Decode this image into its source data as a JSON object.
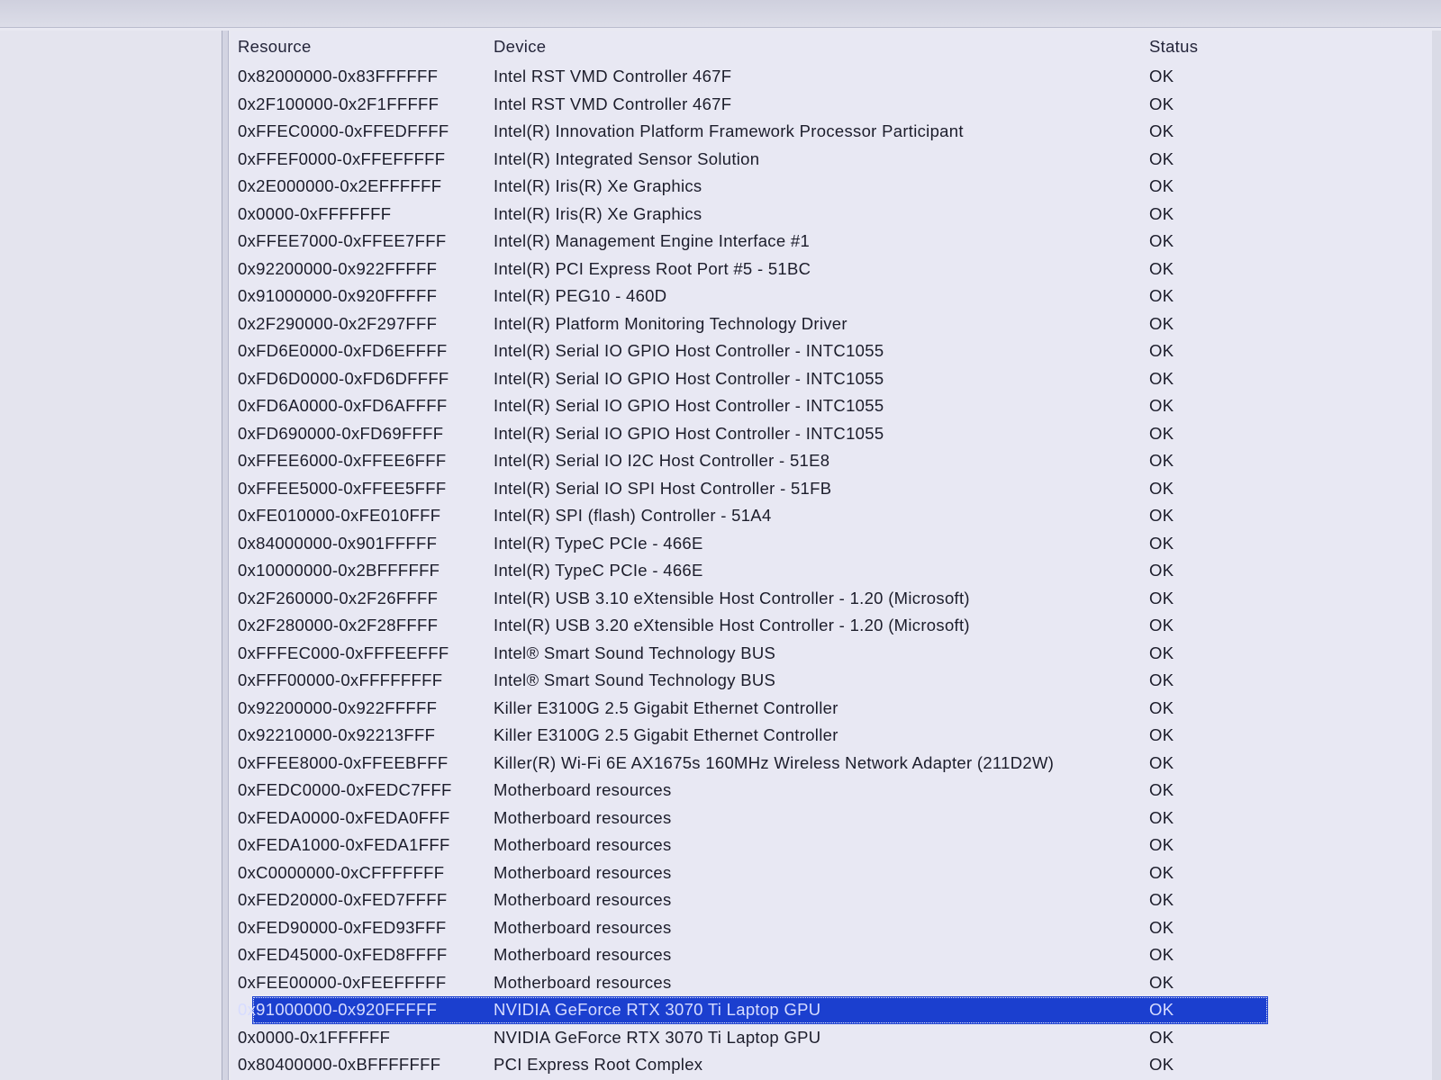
{
  "columns": {
    "resource": "Resource",
    "device": "Device",
    "status": "Status"
  },
  "rows": [
    {
      "resource": "0x82000000-0x83FFFFFF",
      "device": "Intel RST VMD Controller 467F",
      "status": "OK"
    },
    {
      "resource": "0x2F100000-0x2F1FFFFF",
      "device": "Intel RST VMD Controller 467F",
      "status": "OK"
    },
    {
      "resource": "0xFFEC0000-0xFFEDFFFF",
      "device": "Intel(R) Innovation Platform Framework Processor Participant",
      "status": "OK"
    },
    {
      "resource": "0xFFEF0000-0xFFEFFFFF",
      "device": "Intel(R) Integrated Sensor Solution",
      "status": "OK"
    },
    {
      "resource": "0x2E000000-0x2EFFFFFF",
      "device": "Intel(R) Iris(R) Xe Graphics",
      "status": "OK"
    },
    {
      "resource": "0x0000-0xFFFFFFF",
      "device": "Intel(R) Iris(R) Xe Graphics",
      "status": "OK"
    },
    {
      "resource": "0xFFEE7000-0xFFEE7FFF",
      "device": "Intel(R) Management Engine Interface #1",
      "status": "OK"
    },
    {
      "resource": "0x92200000-0x922FFFFF",
      "device": "Intel(R) PCI Express Root Port #5 - 51BC",
      "status": "OK"
    },
    {
      "resource": "0x91000000-0x920FFFFF",
      "device": "Intel(R) PEG10 - 460D",
      "status": "OK"
    },
    {
      "resource": "0x2F290000-0x2F297FFF",
      "device": "Intel(R) Platform Monitoring Technology Driver",
      "status": "OK"
    },
    {
      "resource": "0xFD6E0000-0xFD6EFFFF",
      "device": "Intel(R) Serial IO GPIO Host Controller - INTC1055",
      "status": "OK"
    },
    {
      "resource": "0xFD6D0000-0xFD6DFFFF",
      "device": "Intel(R) Serial IO GPIO Host Controller - INTC1055",
      "status": "OK"
    },
    {
      "resource": "0xFD6A0000-0xFD6AFFFF",
      "device": "Intel(R) Serial IO GPIO Host Controller - INTC1055",
      "status": "OK"
    },
    {
      "resource": "0xFD690000-0xFD69FFFF",
      "device": "Intel(R) Serial IO GPIO Host Controller - INTC1055",
      "status": "OK"
    },
    {
      "resource": "0xFFEE6000-0xFFEE6FFF",
      "device": "Intel(R) Serial IO I2C Host Controller - 51E8",
      "status": "OK"
    },
    {
      "resource": "0xFFEE5000-0xFFEE5FFF",
      "device": "Intel(R) Serial IO SPI Host Controller - 51FB",
      "status": "OK"
    },
    {
      "resource": "0xFE010000-0xFE010FFF",
      "device": "Intel(R) SPI (flash) Controller - 51A4",
      "status": "OK"
    },
    {
      "resource": "0x84000000-0x901FFFFF",
      "device": "Intel(R) TypeC PCIe - 466E",
      "status": "OK"
    },
    {
      "resource": "0x10000000-0x2BFFFFFF",
      "device": "Intel(R) TypeC PCIe - 466E",
      "status": "OK"
    },
    {
      "resource": "0x2F260000-0x2F26FFFF",
      "device": "Intel(R) USB 3.10 eXtensible Host Controller - 1.20 (Microsoft)",
      "status": "OK"
    },
    {
      "resource": "0x2F280000-0x2F28FFFF",
      "device": "Intel(R) USB 3.20 eXtensible Host Controller - 1.20 (Microsoft)",
      "status": "OK"
    },
    {
      "resource": "0xFFFEC000-0xFFFEEFFF",
      "device": "Intel® Smart Sound Technology BUS",
      "status": "OK"
    },
    {
      "resource": "0xFFF00000-0xFFFFFFFF",
      "device": "Intel® Smart Sound Technology BUS",
      "status": "OK"
    },
    {
      "resource": "0x92200000-0x922FFFFF",
      "device": "Killer E3100G 2.5 Gigabit Ethernet Controller",
      "status": "OK"
    },
    {
      "resource": "0x92210000-0x92213FFF",
      "device": "Killer E3100G 2.5 Gigabit Ethernet Controller",
      "status": "OK"
    },
    {
      "resource": "0xFFEE8000-0xFFEEBFFF",
      "device": "Killer(R) Wi-Fi 6E AX1675s 160MHz Wireless Network Adapter (211D2W)",
      "status": "OK"
    },
    {
      "resource": "0xFEDC0000-0xFEDC7FFF",
      "device": "Motherboard resources",
      "status": "OK"
    },
    {
      "resource": "0xFEDA0000-0xFEDA0FFF",
      "device": "Motherboard resources",
      "status": "OK"
    },
    {
      "resource": "0xFEDA1000-0xFEDA1FFF",
      "device": "Motherboard resources",
      "status": "OK"
    },
    {
      "resource": "0xC0000000-0xCFFFFFFF",
      "device": "Motherboard resources",
      "status": "OK"
    },
    {
      "resource": "0xFED20000-0xFED7FFFF",
      "device": "Motherboard resources",
      "status": "OK"
    },
    {
      "resource": "0xFED90000-0xFED93FFF",
      "device": "Motherboard resources",
      "status": "OK"
    },
    {
      "resource": "0xFED45000-0xFED8FFFF",
      "device": "Motherboard resources",
      "status": "OK"
    },
    {
      "resource": "0xFEE00000-0xFEEFFFFF",
      "device": "Motherboard resources",
      "status": "OK"
    },
    {
      "resource": "0x91000000-0x920FFFFF",
      "device": "NVIDIA GeForce RTX 3070 Ti Laptop GPU",
      "status": "OK",
      "selected": true
    },
    {
      "resource": "0x0000-0x1FFFFFF",
      "device": "NVIDIA GeForce RTX 3070 Ti Laptop GPU",
      "status": "OK"
    },
    {
      "resource": "0x80400000-0xBFFFFFFF",
      "device": "PCI Express Root Complex",
      "status": "OK"
    }
  ],
  "colors": {
    "selection": "#1b3fcf",
    "background": "#e8e8f3"
  }
}
